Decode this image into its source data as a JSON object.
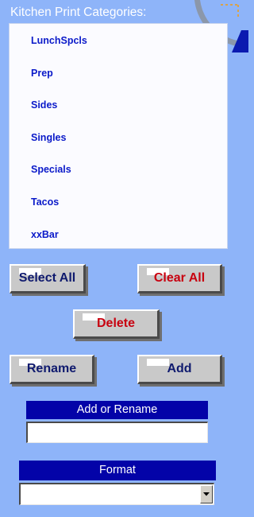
{
  "panel": {
    "title": "Kitchen Print Categories:"
  },
  "categories": [
    "LunchSpcls",
    "Prep",
    "Sides",
    "Singles",
    "Specials",
    "Tacos",
    "xxBar"
  ],
  "buttons": {
    "select_all": "Select All",
    "clear_all": "Clear All",
    "delete": "Delete",
    "rename": "Rename",
    "add": "Add"
  },
  "add_or_rename": {
    "label": "Add or Rename",
    "value": ""
  },
  "format": {
    "label": "Format",
    "selected": ""
  },
  "icons": {
    "decoration": "ring-decoration-icon",
    "dropdown": "chevron-down-icon"
  },
  "colors": {
    "background": "#8eb4f9",
    "header_bar": "#0303a8",
    "list_text": "#0b1ac9",
    "button_face": "#c9c9c9",
    "navy_label": "#0f1a6e",
    "red_label": "#c8000f"
  }
}
